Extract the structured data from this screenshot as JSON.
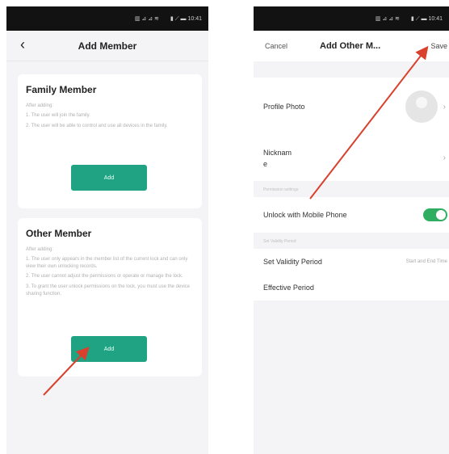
{
  "status_bar": {
    "left_icons": "▥ ⊿ ⊿ ≋",
    "right_info": "▮ ⟋ ▬ 10:41"
  },
  "left": {
    "title": "Add Member",
    "back_icon": "chevron-left-icon",
    "family": {
      "heading": "Family Member",
      "sub": "After adding:",
      "lines": [
        "1. The user will join the family.",
        "2. The user will be able to control and use all devices in the family."
      ],
      "button": "Add"
    },
    "other": {
      "heading": "Other Member",
      "sub": "After adding:",
      "lines": [
        "1. The user only appears in the member list of the current lock and can only view their own unlocking records.",
        "2. The user cannot adjust the permissions or operate or manage the lock.",
        "3. To grant the user unlock permissions on the lock, you must use the device sharing function."
      ],
      "button": "Add"
    }
  },
  "right": {
    "cancel": "Cancel",
    "title": "Add Other M...",
    "save": "Save",
    "profile_photo": "Profile Photo",
    "nickname": "Nicknam\ne",
    "section_permission": "Permission settings",
    "unlock_label": "Unlock with Mobile Phone",
    "unlock_enabled": true,
    "section_validity": "Set Validity Period",
    "validity_label": "Set Validity Period",
    "validity_value": "Start and End Time",
    "effective_label": "Effective Period"
  },
  "colors": {
    "accent_green": "#1fa382",
    "toggle_green": "#2fae62",
    "annotation_red": "#d9412e"
  }
}
